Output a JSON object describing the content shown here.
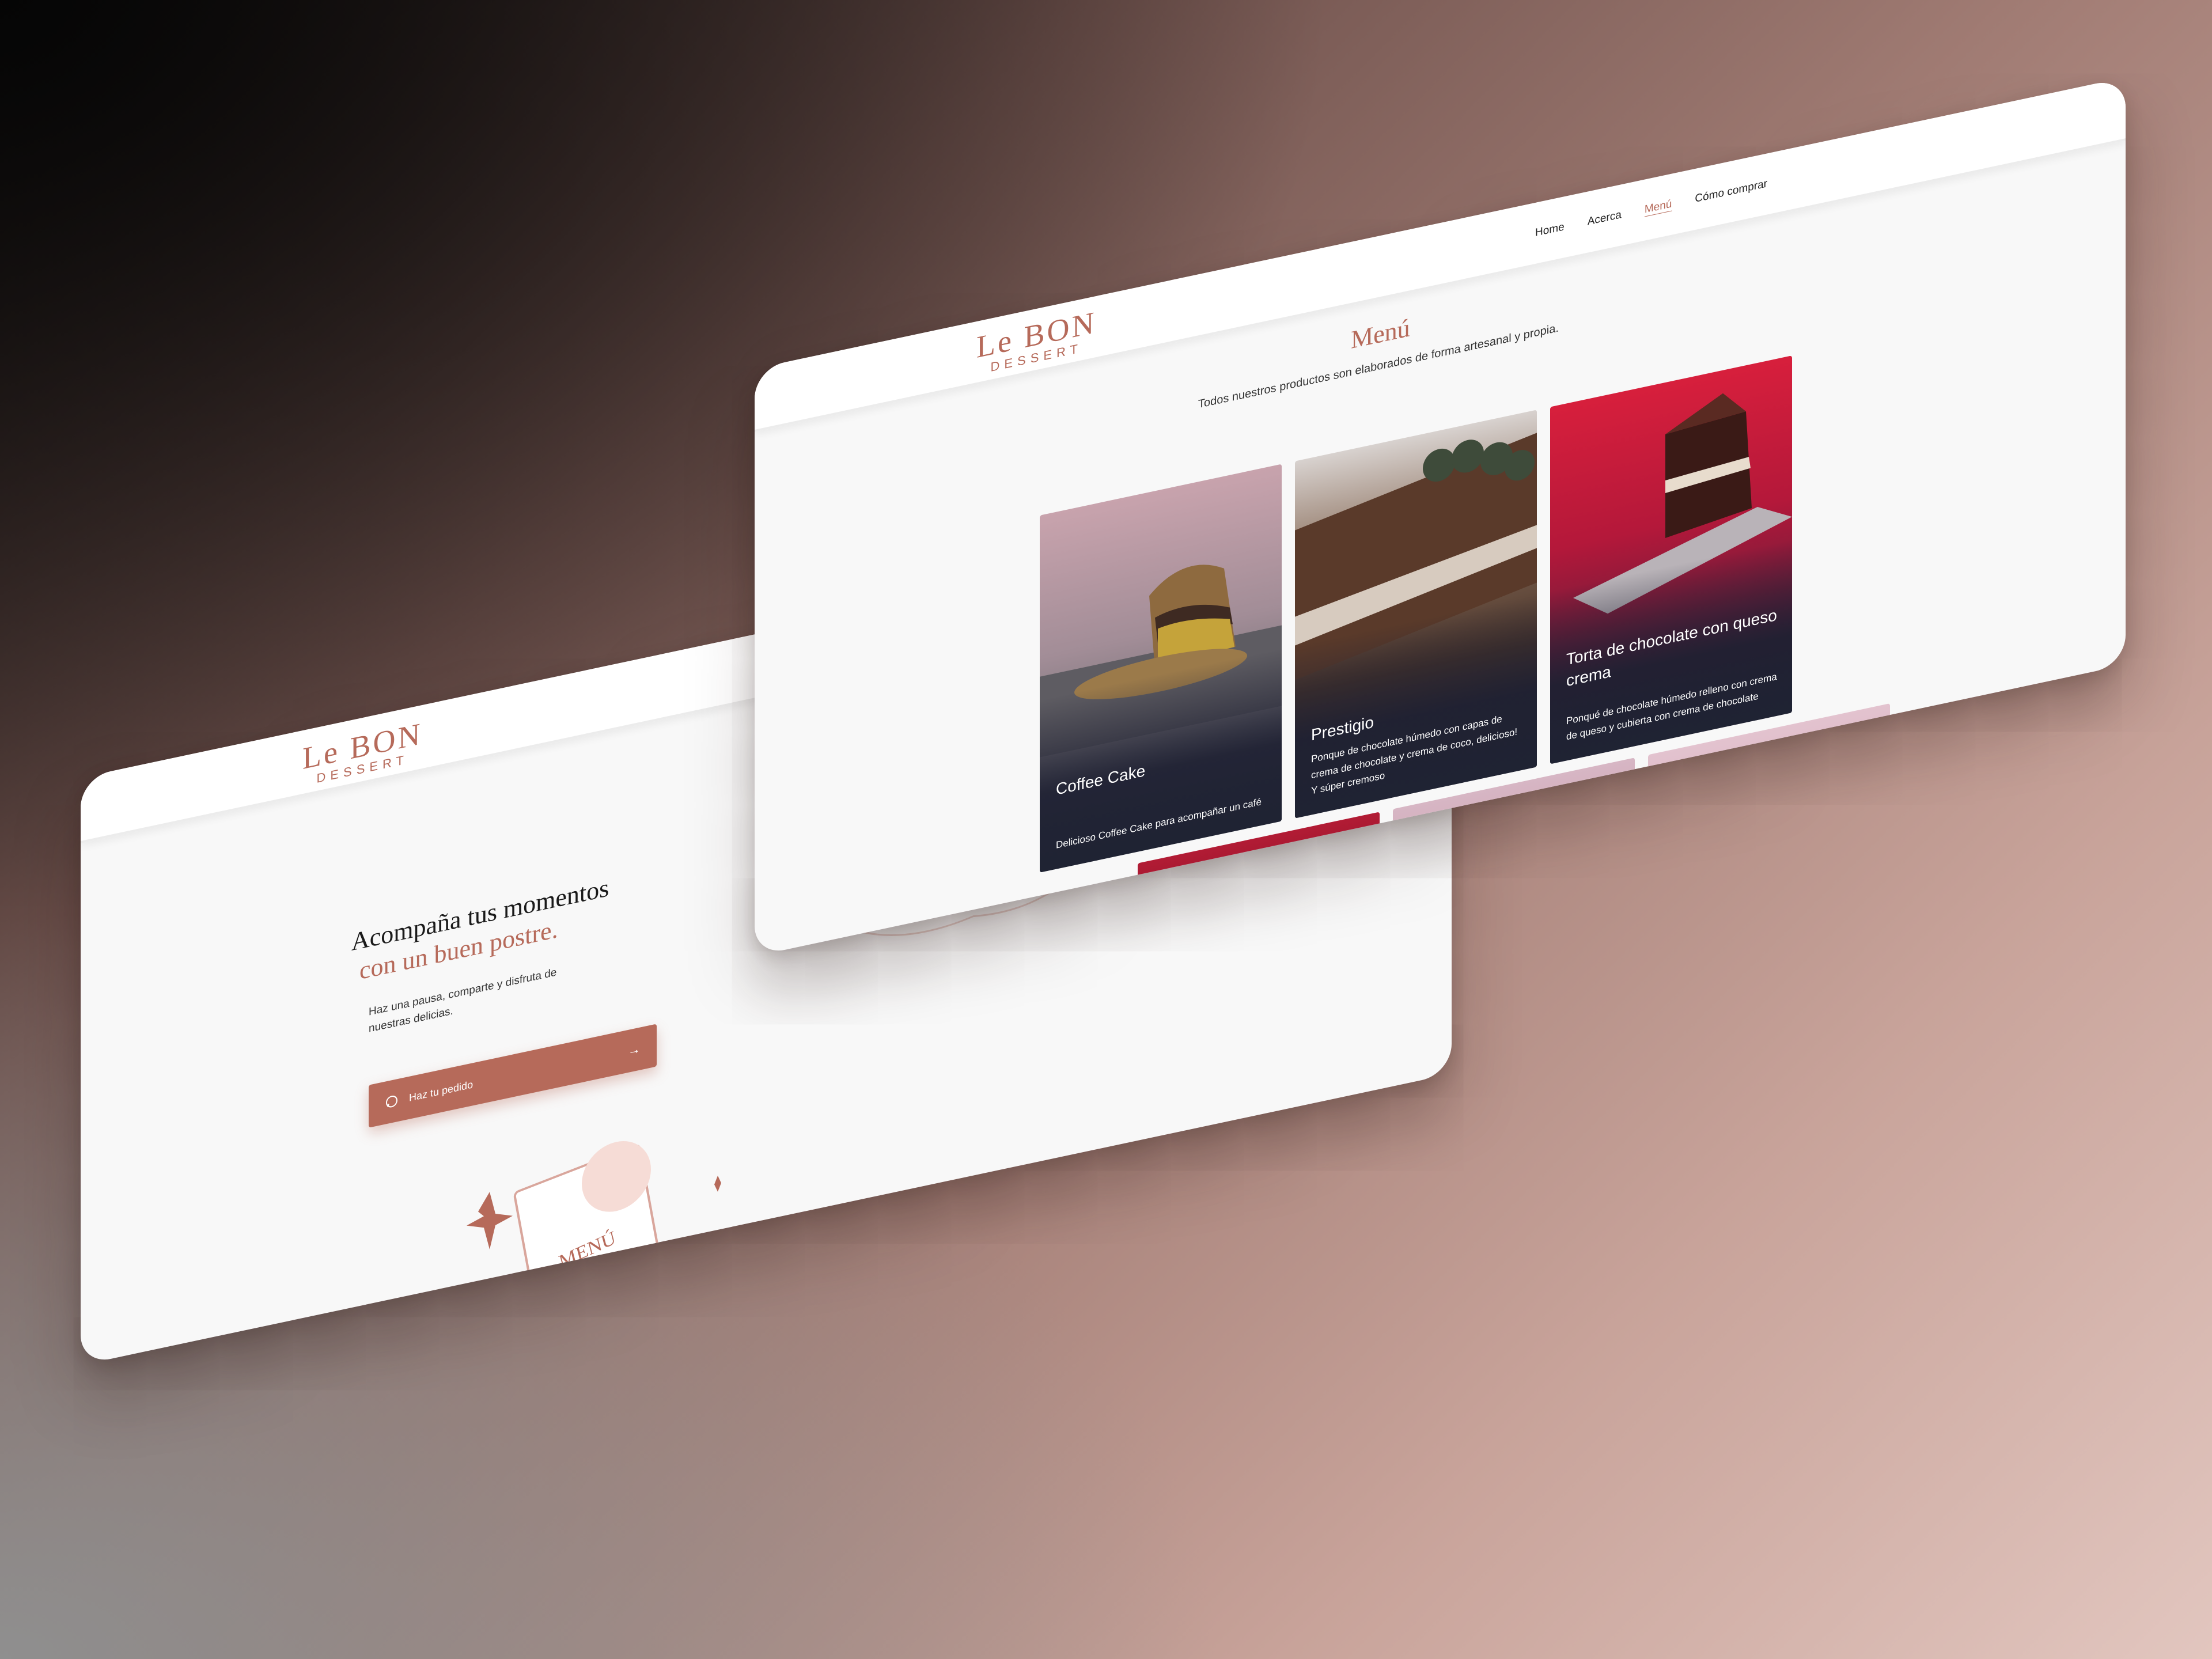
{
  "brand": {
    "logo_top": "Le BON",
    "logo_bottom": "DESSERT"
  },
  "colors": {
    "accent": "#b66a5a",
    "card_bg": "#f8f8f8",
    "tile_overlay": "#1f2333"
  },
  "menu_page": {
    "nav": [
      {
        "label": "Home"
      },
      {
        "label": "Acerca"
      },
      {
        "label": "Menú",
        "active": true
      },
      {
        "label": "Cómo comprar"
      }
    ],
    "title": "Menú",
    "subtitle": "Todos nuestros productos son elaborados de forma artesanal y propia.",
    "products": [
      {
        "name": "Coffee Cake",
        "description": "Delicioso Coffee Cake para acompañar un café"
      },
      {
        "name": "Prestigio",
        "description": "Ponque de chocolate húmedo con capas de crema de chocolate y crema de coco, delicioso! Y súper cremoso"
      },
      {
        "name": "Torta de chocolate con queso crema",
        "description": "Ponqué de chocolate húmedo relleno con crema de queso y cubierta con crema de chocolate"
      }
    ]
  },
  "home_page": {
    "hero_line1": "Acompaña tus momentos",
    "hero_line2": "con un buen postre.",
    "hero_text": "Haz una pausa, comparte y disfruta de nuestras delicias.",
    "cta_label": "Haz tu pedido",
    "cta_icon": "whatsapp-icon",
    "cta_arrow": "→",
    "illustration_text": "MENÚ"
  }
}
